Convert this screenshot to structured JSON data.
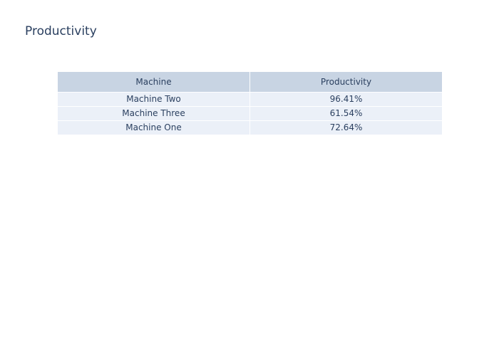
{
  "chart_data": {
    "type": "table",
    "title": "Productivity",
    "columns": [
      "Machine",
      "Productivity"
    ],
    "rows": [
      [
        "Machine Two",
        "96.41%"
      ],
      [
        "Machine Three",
        "61.54%"
      ],
      [
        "Machine One",
        "72.64%"
      ]
    ],
    "colors": {
      "header_fill": "#c8d4e3",
      "cell_fill": "#ebf0f8",
      "text": "#2a3f5f"
    }
  }
}
